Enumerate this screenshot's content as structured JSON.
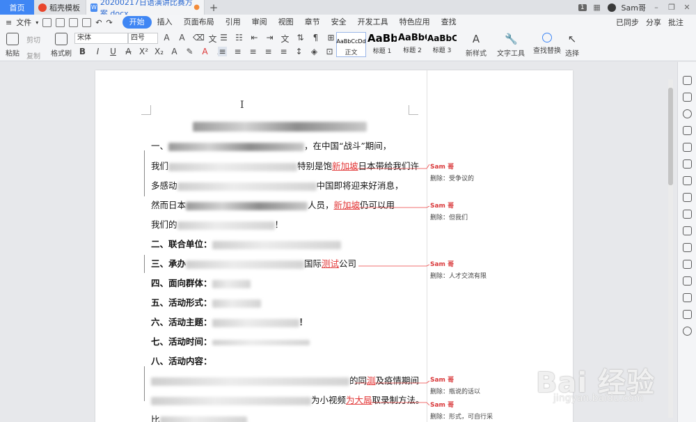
{
  "tabs": {
    "home": "首页",
    "tab1": "稻壳模板",
    "tab2": "20200217日语演讲比赛方案.docx",
    "add": "+",
    "page_badge": "1",
    "user": "Sam哥"
  },
  "menubar": {
    "file": "文件",
    "items": [
      "开始",
      "插入",
      "页面布局",
      "引用",
      "审阅",
      "视图",
      "章节",
      "安全",
      "开发工具",
      "特色应用",
      "查找"
    ],
    "right": [
      "已同步",
      "分享",
      "批注"
    ]
  },
  "ribbon": {
    "paste": "粘贴",
    "cut": "剪切",
    "copy": "复制",
    "format_painter": "格式刷",
    "font_name": "宋体",
    "font_size": "四号",
    "styles": [
      {
        "preview": "AaBbCcDd",
        "caption": "正文"
      },
      {
        "preview": "AaBb",
        "caption": "标题 1"
      },
      {
        "preview": "AaBbC",
        "caption": "标题 2"
      },
      {
        "preview": "AaBbC",
        "caption": "标题 3"
      }
    ],
    "new_style": "新样式",
    "text_tools": "文字工具",
    "find_replace": "查找替换",
    "select": "选择"
  },
  "document": {
    "lines": [
      {
        "id": "l1",
        "pre": "一、",
        "suffix": "，在中国“战斗”期间，"
      },
      {
        "id": "l2",
        "pre": "我们",
        "mid": "特别是饱",
        "red": "新加坡",
        "suffix": "日本带给我们许"
      },
      {
        "id": "l3",
        "pre": "多感动",
        "suffix": "中国即将迎来好消息，"
      },
      {
        "id": "l4",
        "pre": "然而日本",
        "mid": "人员，",
        "red": "新加坡",
        "suffix": "仍可以用"
      },
      {
        "id": "l5",
        "pre": "我们的",
        "suffix": "！"
      },
      {
        "id": "l6",
        "pre": "二、联合单位："
      },
      {
        "id": "l7",
        "pre": "三、承办",
        "mid": "国际",
        "red": "测试",
        "suffix": "公司"
      },
      {
        "id": "l8",
        "pre": "四、面向群体："
      },
      {
        "id": "l9",
        "pre": "五、活动形式："
      },
      {
        "id": "l10",
        "pre": "六、活动主题：",
        "suffix": "！"
      },
      {
        "id": "l11",
        "pre": "七、活动时间："
      },
      {
        "id": "l12",
        "pre": "八、活动内容："
      },
      {
        "id": "l13",
        "mid": "的同",
        "red": "测",
        "suffix": "及疫情期间"
      },
      {
        "id": "l14",
        "mid": "为小视频",
        "red": "为大局",
        "suffix": "取录制方法。"
      },
      {
        "id": "l15",
        "pre": "比"
      }
    ]
  },
  "comments": [
    {
      "author": "Sam 哥",
      "text": "删除：受争议的"
    },
    {
      "author": "Sam 哥",
      "text": "删除：但我们"
    },
    {
      "author": "Sam 哥",
      "text": "删除：人才交流有限"
    },
    {
      "author": "Sam 哥",
      "text": "删除：瓶说的话以"
    },
    {
      "author": "Sam 哥",
      "text": "删除：形式，可自行采"
    }
  ],
  "watermark": {
    "main": "Bai 经验",
    "sub": "jingyan.baidu.com"
  }
}
